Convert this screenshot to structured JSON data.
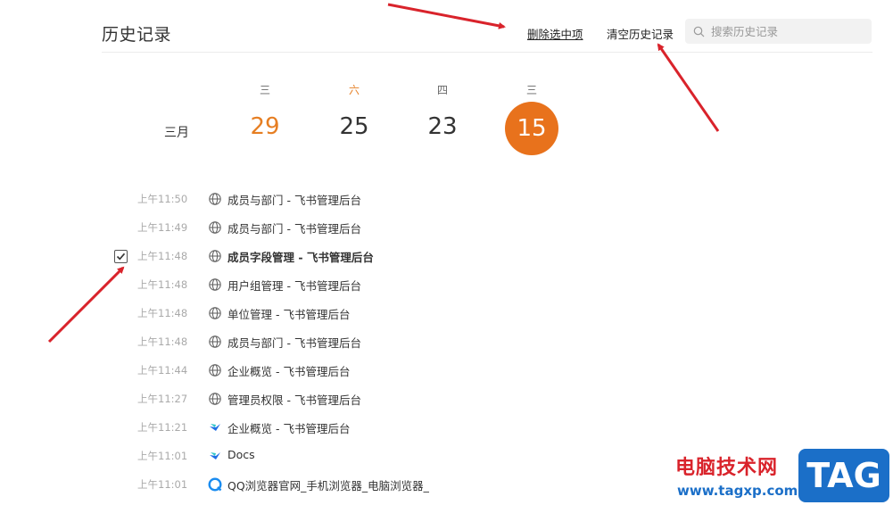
{
  "header": {
    "title": "历史记录",
    "delete_selected": "删除选中项",
    "clear_history": "清空历史记录",
    "search_placeholder": "搜索历史记录"
  },
  "calendar": {
    "month": "三月",
    "days": [
      {
        "weekday": "三",
        "day": "29"
      },
      {
        "weekday": "六",
        "day": "25"
      },
      {
        "weekday": "四",
        "day": "23"
      },
      {
        "weekday": "三",
        "day": "15"
      }
    ]
  },
  "history": [
    {
      "time": "上午11:50",
      "title": "成员与部门 - 飞书管理后台",
      "icon": "globe-icon"
    },
    {
      "time": "上午11:49",
      "title": "成员与部门 - 飞书管理后台",
      "icon": "globe-icon"
    },
    {
      "time": "上午11:48",
      "title": "成员字段管理 - 飞书管理后台",
      "icon": "globe-icon",
      "checked": true
    },
    {
      "time": "上午11:48",
      "title": "用户组管理 - 飞书管理后台",
      "icon": "globe-icon"
    },
    {
      "time": "上午11:48",
      "title": "单位管理 - 飞书管理后台",
      "icon": "globe-icon"
    },
    {
      "time": "上午11:48",
      "title": "成员与部门 - 飞书管理后台",
      "icon": "globe-icon"
    },
    {
      "time": "上午11:44",
      "title": "企业概览 - 飞书管理后台",
      "icon": "globe-icon"
    },
    {
      "time": "上午11:27",
      "title": "管理员权限 - 飞书管理后台",
      "icon": "globe-icon"
    },
    {
      "time": "上午11:21",
      "title": "企业概览 - 飞书管理后台",
      "icon": "feishu-icon"
    },
    {
      "time": "上午11:01",
      "title": "Docs",
      "icon": "feishu-icon"
    },
    {
      "time": "上午11:01",
      "title": "QQ浏览器官网_手机浏览器_电脑浏览器_",
      "icon": "qq-browser-icon"
    }
  ],
  "watermark": {
    "line1": "电脑技术网",
    "line2": "www.tagxp.com",
    "tag": "TAG"
  },
  "colors": {
    "accent": "#e8721c",
    "annotation_arrow": "#d9232b"
  }
}
